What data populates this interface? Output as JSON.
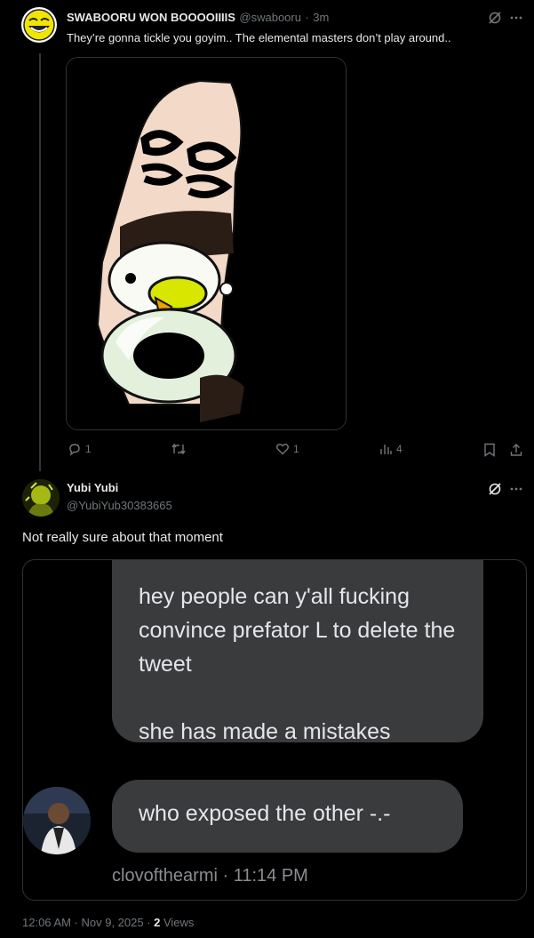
{
  "post1": {
    "display_name": "SWABOORU WON BOOOOIIIIS",
    "handle": "@swabooru",
    "separator": "·",
    "time": "3m",
    "text": "They’re gonna tickle you goyim.. The elemental masters don’t play around..",
    "actions": {
      "replies": "1",
      "retweets": "",
      "likes": "1",
      "views": "4"
    }
  },
  "post2": {
    "display_name": "Yubi Yubi",
    "handle": "@YubiYub30383665",
    "text": "Not really sure about that moment",
    "embedded": {
      "message1": "hey people can y'all fucking convince prefator L to delete the tweet\n\nshe has made a mistakes",
      "message2": "who exposed the other -.-",
      "footer": "clovofthearmi · 11:14 PM"
    },
    "meta": {
      "timestamp": "12:06 AM · Nov 9, 2025 · ",
      "views_count": "2",
      "views_label": " Views"
    }
  },
  "colors": {
    "background": "#000000",
    "text": "#e7e9ea",
    "muted": "#71767b",
    "border": "#2f3336",
    "bubble": "#3a3b3d"
  },
  "icons": [
    "grok-icon",
    "more-icon",
    "reply-icon",
    "retweet-icon",
    "like-icon",
    "views-icon",
    "bookmark-icon",
    "share-icon"
  ]
}
